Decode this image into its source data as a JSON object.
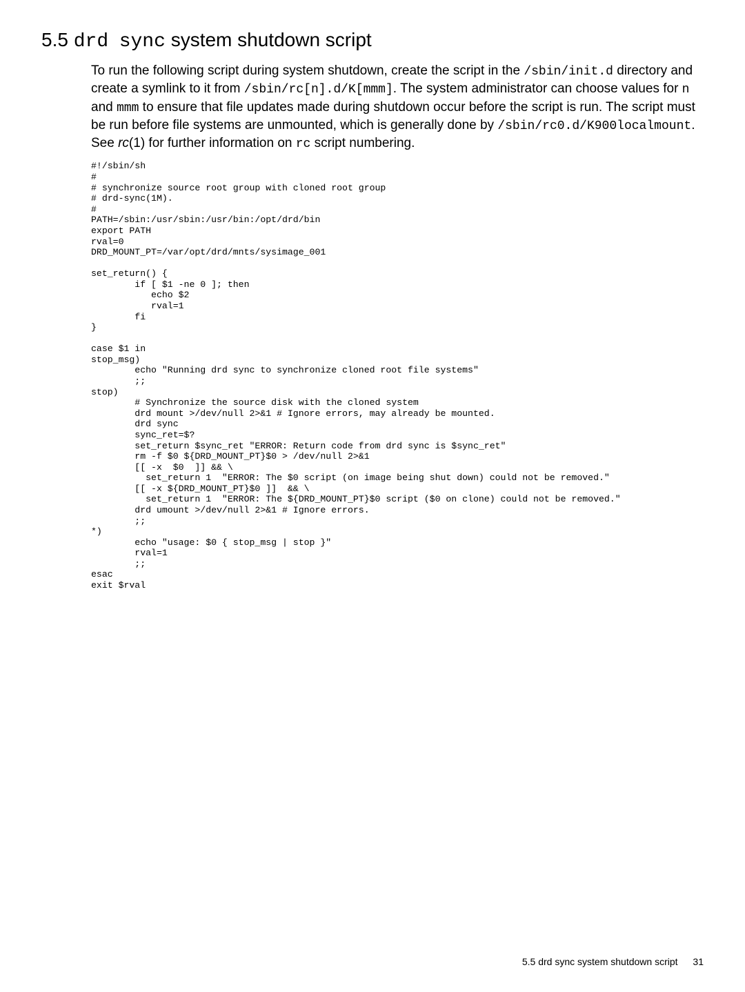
{
  "heading": {
    "number": "5.5",
    "code1": "drd",
    "code2": "sync",
    "rest": "system shutdown script"
  },
  "intro": {
    "s1a": "To run the following script during system shutdown, create the script in the ",
    "c1": "/sbin/init.d",
    "s1b": " directory and create a symlink to it from ",
    "c2": "/sbin/rc[n].d/K[mmm]",
    "s1c": ". The system administrator can choose values for ",
    "c3": "n",
    "s1d": " and ",
    "c4": "mmm",
    "s1e": " to ensure that file updates made during shutdown occur before the script is run. The script must be run before file systems are unmounted, which is generally done by ",
    "c5": "/sbin/rc0.d/K900localmount",
    "s1f": ". See ",
    "i1": "rc",
    "s1g": "(1) for further information on ",
    "c6": "rc",
    "s1h": " script numbering."
  },
  "code": "#!/sbin/sh\n#\n# synchronize source root group with cloned root group\n# drd-sync(1M).\n#\nPATH=/sbin:/usr/sbin:/usr/bin:/opt/drd/bin\nexport PATH\nrval=0\nDRD_MOUNT_PT=/var/opt/drd/mnts/sysimage_001\n\nset_return() {\n        if [ $1 -ne 0 ]; then\n           echo $2\n           rval=1\n        fi\n}\n\ncase $1 in\nstop_msg)\n        echo \"Running drd sync to synchronize cloned root file systems\"\n        ;;\nstop)\n        # Synchronize the source disk with the cloned system\n        drd mount >/dev/null 2>&1 # Ignore errors, may already be mounted.\n        drd sync\n        sync_ret=$?\n        set_return $sync_ret \"ERROR: Return code from drd sync is $sync_ret\"\n        rm -f $0 ${DRD_MOUNT_PT}$0 > /dev/null 2>&1\n        [[ -x  $0  ]] && \\\n          set_return 1  \"ERROR: The $0 script (on image being shut down) could not be removed.\"\n        [[ -x ${DRD_MOUNT_PT}$0 ]]  && \\\n          set_return 1  \"ERROR: The ${DRD_MOUNT_PT}$0 script ($0 on clone) could not be removed.\"\n        drd umount >/dev/null 2>&1 # Ignore errors.\n        ;;\n*)\n        echo \"usage: $0 { stop_msg | stop }\"\n        rval=1\n        ;;\nesac\nexit $rval",
  "footer": {
    "text": "5.5 drd sync system shutdown script",
    "page": "31"
  }
}
